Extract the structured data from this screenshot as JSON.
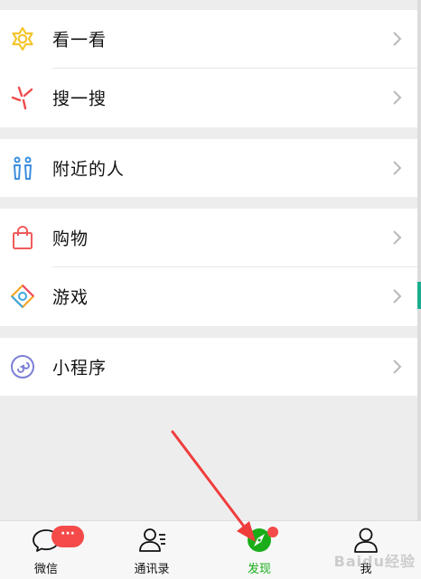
{
  "menu": {
    "groups": [
      {
        "items": [
          {
            "label": "看一看",
            "icon": "look-icon"
          },
          {
            "label": "搜一搜",
            "icon": "search-icon"
          }
        ]
      },
      {
        "items": [
          {
            "label": "附近的人",
            "icon": "people-nearby-icon"
          }
        ]
      },
      {
        "items": [
          {
            "label": "购物",
            "icon": "shopping-bag-icon"
          },
          {
            "label": "游戏",
            "icon": "game-icon"
          }
        ]
      },
      {
        "items": [
          {
            "label": "小程序",
            "icon": "mini-program-icon"
          }
        ]
      }
    ]
  },
  "tabbar": {
    "tabs": [
      {
        "label": "微信",
        "icon": "chat-icon"
      },
      {
        "label": "通讯录",
        "icon": "contacts-icon"
      },
      {
        "label": "发现",
        "icon": "discover-icon",
        "active": true
      },
      {
        "label": "我",
        "icon": "me-icon"
      }
    ],
    "chat_badge": "···"
  },
  "watermark": "Baidu经验",
  "colors": {
    "active_green": "#1aad19",
    "badge_red": "#f44a4a",
    "annotation_arrow": "#f03c3c"
  }
}
